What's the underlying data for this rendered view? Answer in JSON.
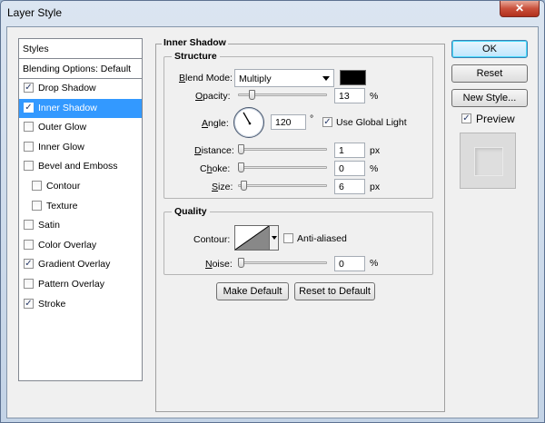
{
  "window": {
    "title": "Layer Style",
    "close_glyph": "✕",
    "close_icon": "close-icon"
  },
  "styles_list": {
    "header": "Styles",
    "blending_options": "Blending Options: Default",
    "items": [
      {
        "label": "Drop Shadow",
        "checked": true,
        "selected": false,
        "sub": false
      },
      {
        "label": "Inner Shadow",
        "checked": true,
        "selected": true,
        "sub": false
      },
      {
        "label": "Outer Glow",
        "checked": false,
        "selected": false,
        "sub": false
      },
      {
        "label": "Inner Glow",
        "checked": false,
        "selected": false,
        "sub": false
      },
      {
        "label": "Bevel and Emboss",
        "checked": false,
        "selected": false,
        "sub": false
      },
      {
        "label": "Contour",
        "checked": false,
        "selected": false,
        "sub": true
      },
      {
        "label": "Texture",
        "checked": false,
        "selected": false,
        "sub": true
      },
      {
        "label": "Satin",
        "checked": false,
        "selected": false,
        "sub": false
      },
      {
        "label": "Color Overlay",
        "checked": false,
        "selected": false,
        "sub": false
      },
      {
        "label": "Gradient Overlay",
        "checked": true,
        "selected": false,
        "sub": false
      },
      {
        "label": "Pattern Overlay",
        "checked": false,
        "selected": false,
        "sub": false
      },
      {
        "label": "Stroke",
        "checked": true,
        "selected": false,
        "sub": false
      }
    ]
  },
  "inner_shadow": {
    "title": "Inner Shadow",
    "structure": {
      "title": "Structure",
      "blend_mode_label": "Blend Mode:",
      "blend_mode_value": "Multiply",
      "shadow_color": "#000000",
      "opacity_label": "Opacity:",
      "opacity_value": "13",
      "opacity_unit": "%",
      "opacity_fraction": 0.13,
      "angle_label": "Angle:",
      "angle_value": "120",
      "angle_unit": "°",
      "use_global_light_label": "Use Global Light",
      "use_global_light_checked": true,
      "distance_label": "Distance:",
      "distance_value": "1",
      "distance_unit": "px",
      "distance_fraction": 0.0,
      "choke_label": "Choke:",
      "choke_value": "0",
      "choke_unit": "%",
      "choke_fraction": 0.0,
      "size_label": "Size:",
      "size_value": "6",
      "size_unit": "px",
      "size_fraction": 0.03
    },
    "quality": {
      "title": "Quality",
      "contour_label": "Contour:",
      "anti_aliased_label": "Anti-aliased",
      "anti_aliased_checked": false,
      "noise_label": "Noise:",
      "noise_value": "0",
      "noise_unit": "%",
      "noise_fraction": 0.0
    },
    "make_default_label": "Make Default",
    "reset_to_default_label": "Reset to Default"
  },
  "actions": {
    "ok_label": "OK",
    "reset_label": "Reset",
    "new_style_label": "New Style...",
    "preview_label": "Preview",
    "preview_checked": true
  },
  "colors": {
    "selection": "#3399ff",
    "check": "#2b3d6b"
  }
}
